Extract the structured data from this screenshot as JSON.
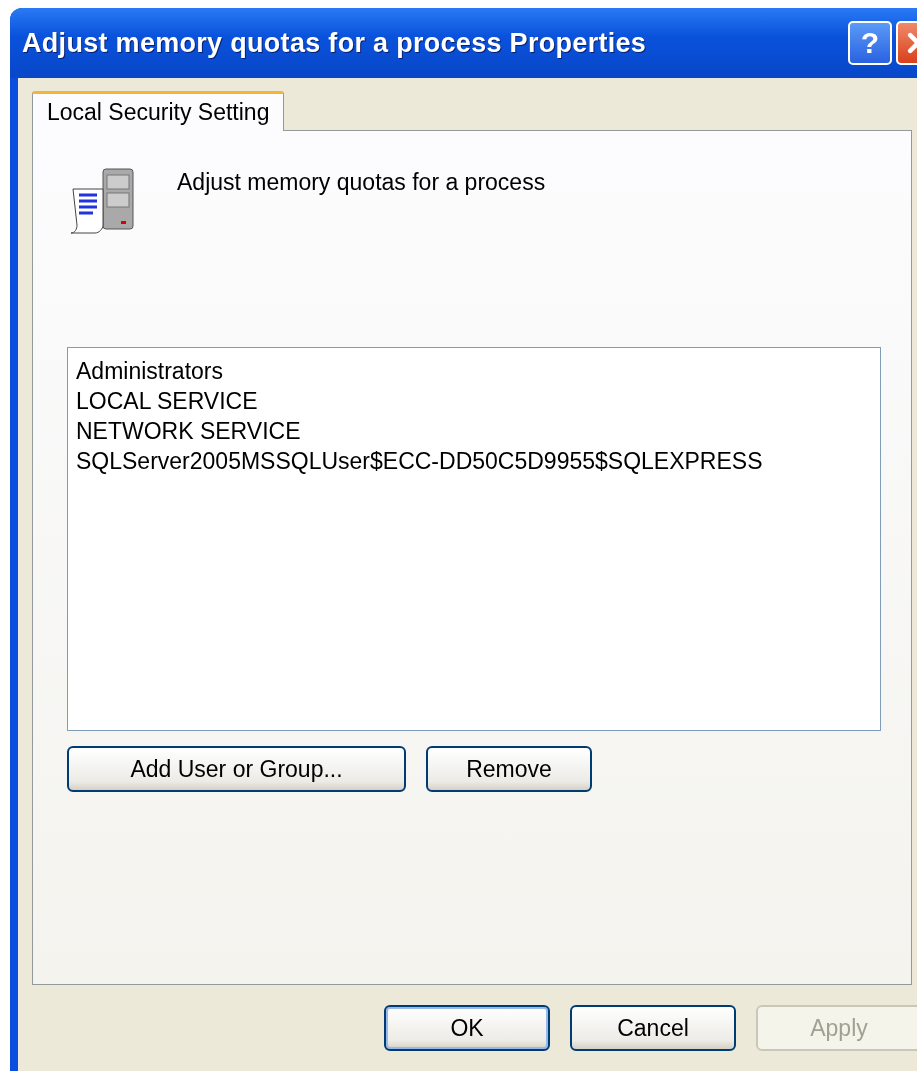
{
  "window": {
    "title": "Adjust memory quotas for a process Properties",
    "help_button": "?"
  },
  "tabs": [
    {
      "label": "Local Security Setting",
      "selected": true
    }
  ],
  "policy": {
    "name": "Adjust memory quotas for a process"
  },
  "members": [
    {
      "name": "Administrators",
      "selected": false
    },
    {
      "name": "LOCAL SERVICE",
      "selected": false
    },
    {
      "name": "NETWORK SERVICE",
      "selected": false
    },
    {
      "name": "SQLServer2005MSSQLUser$ECC-DD50C5D9955$SQLEXPRESS",
      "selected": false
    }
  ],
  "member_buttons": [
    {
      "label": "Add User or Group...",
      "disabled": false
    },
    {
      "label": "Remove",
      "disabled": false
    }
  ],
  "dialog_buttons": [
    {
      "label": "OK",
      "default": true,
      "disabled": false
    },
    {
      "label": "Cancel",
      "default": false,
      "disabled": false
    },
    {
      "label": "Apply",
      "default": false,
      "disabled": true
    }
  ]
}
